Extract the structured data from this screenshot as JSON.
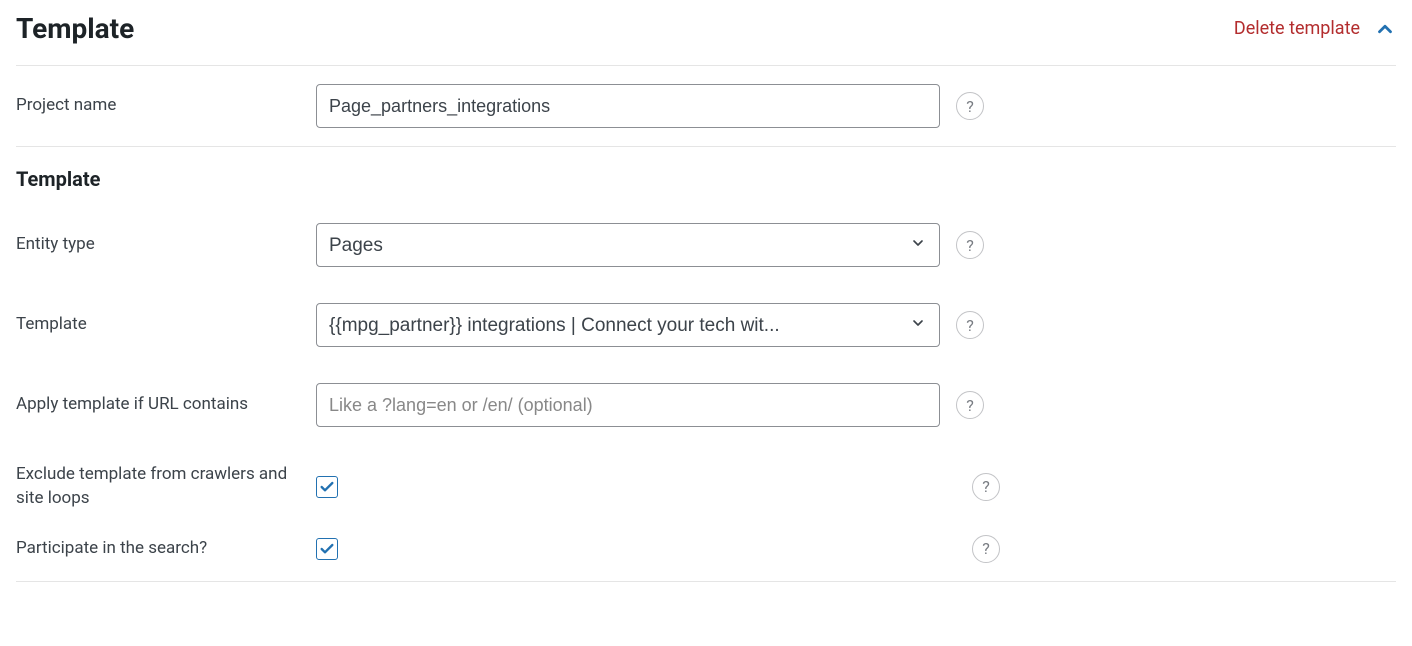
{
  "header": {
    "title": "Template",
    "delete_label": "Delete template"
  },
  "rows": {
    "project_name": {
      "label": "Project name",
      "value": "Page_partners_integrations"
    },
    "template_subheading": "Template",
    "entity_type": {
      "label": "Entity type",
      "value": "Pages"
    },
    "template": {
      "label": "Template",
      "value": "{{mpg_partner}} integrations | Connect your tech wit..."
    },
    "apply_if_url": {
      "label": "Apply template if URL contains",
      "placeholder": "Like a ?lang=en or /en/ (optional)",
      "value": ""
    },
    "exclude_crawlers": {
      "label": "Exclude template from crawlers and site loops",
      "checked": true
    },
    "participate_search": {
      "label": "Participate in the search?",
      "checked": true
    }
  },
  "helptext": "?"
}
